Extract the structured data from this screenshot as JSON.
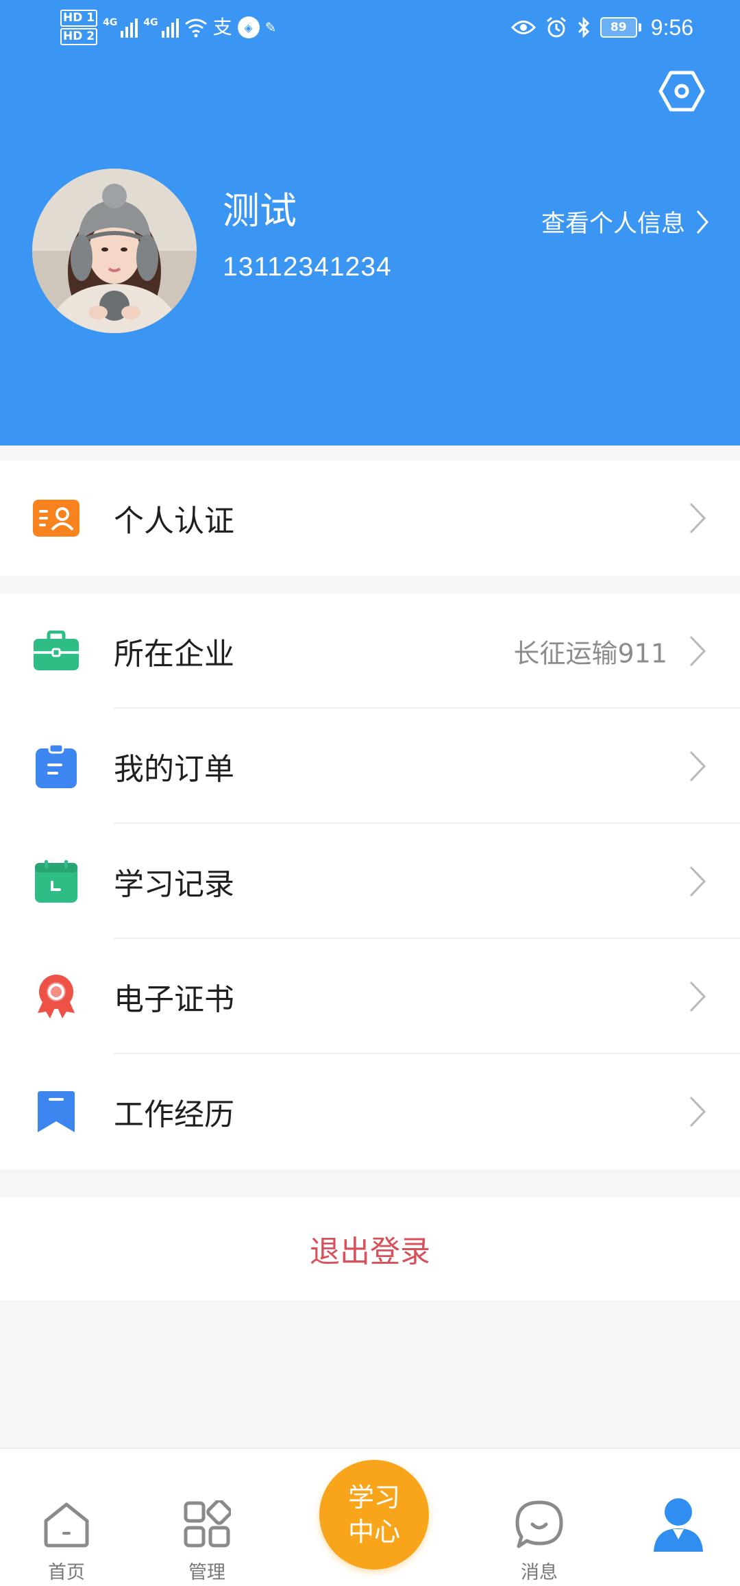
{
  "status_bar": {
    "hd1": "HD 1",
    "hd2": "HD 2",
    "net1": "4G",
    "net2": "4G",
    "battery": "89",
    "time": "9:56"
  },
  "header": {
    "background_color": "#3a96f2",
    "user_name": "测试",
    "phone": "13112341234",
    "view_info_label": "查看个人信息"
  },
  "menu_group_1": [
    {
      "label": "个人认证",
      "icon": "id-card-icon",
      "color": "#f7821e"
    }
  ],
  "menu_group_2": [
    {
      "label": "所在企业",
      "value": "长征运输911",
      "icon": "briefcase-icon",
      "color": "#2ebd85"
    },
    {
      "label": "我的订单",
      "icon": "clipboard-icon",
      "color": "#3d86f0"
    },
    {
      "label": "学习记录",
      "icon": "calendar-icon",
      "color": "#2ebd85"
    },
    {
      "label": "电子证书",
      "icon": "award-ribbon-icon",
      "color": "#ee5246"
    },
    {
      "label": "工作经历",
      "icon": "bookmark-icon",
      "color": "#3d86f0"
    }
  ],
  "logout_label": "退出登录",
  "tabbar": {
    "home": "首页",
    "manage": "管理",
    "center_line1": "学习",
    "center_line2": "中心",
    "messages": "消息",
    "active_color": "#2f8ef0",
    "center_color": "#f8a51c"
  }
}
